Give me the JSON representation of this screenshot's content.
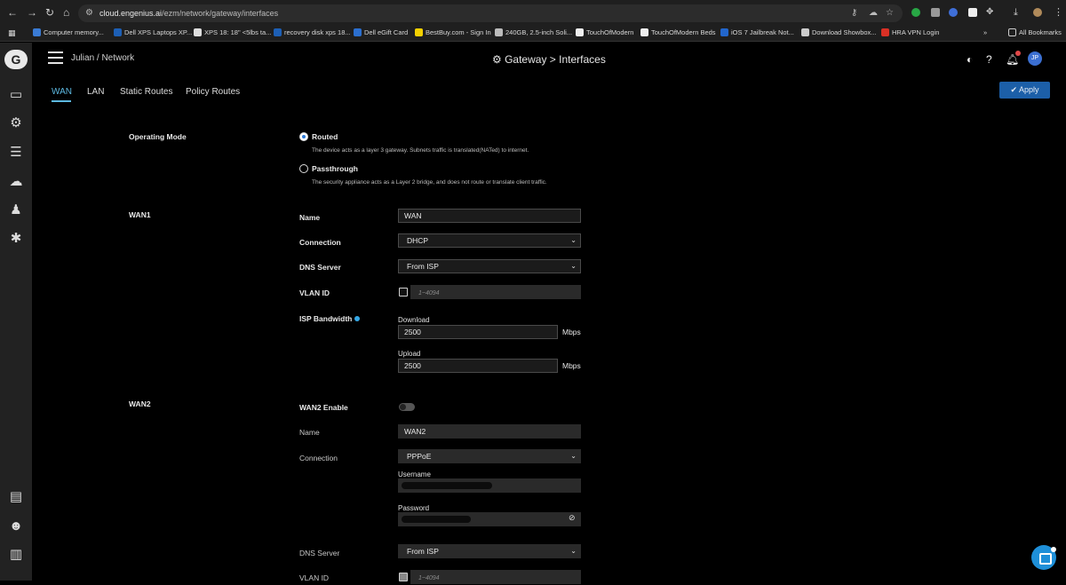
{
  "browser": {
    "url_host": "cloud.engenius.ai",
    "url_path": "/ezm/network/gateway/interfaces",
    "bookmarks": [
      {
        "label": "Computer memory...",
        "color": "#3a7bd5"
      },
      {
        "label": "Dell XPS Laptops XP...",
        "color": "#1d5fb5"
      },
      {
        "label": "XPS 18: 18\" <5lbs ta...",
        "color": "#dddddd"
      },
      {
        "label": "recovery disk xps 18...",
        "color": "#1d5fb5"
      },
      {
        "label": "Dell eGift Card",
        "color": "#2b6fcf"
      },
      {
        "label": "BestBuy.com - Sign In",
        "color": "#f3d000"
      },
      {
        "label": "240GB, 2.5-inch Soli...",
        "color": "#bbbbbb"
      },
      {
        "label": "TouchOfModern",
        "color": "#eeeeee"
      },
      {
        "label": "TouchOfModern Beds",
        "color": "#eeeeee"
      },
      {
        "label": "iOS 7 Jailbreak Not...",
        "color": "#2266cc"
      },
      {
        "label": "Download Showbox...",
        "color": "#cccccc"
      },
      {
        "label": "HRA VPN Login",
        "color": "#d93025"
      }
    ],
    "all_bookmarks": "All Bookmarks"
  },
  "header": {
    "breadcrumb": "Julian / Network",
    "title": "Gateway > Interfaces",
    "avatar": "JP"
  },
  "tabs": [
    "WAN",
    "LAN",
    "Static Routes",
    "Policy Routes"
  ],
  "apply_label": "Apply",
  "operating_mode": {
    "label": "Operating Mode",
    "routed": {
      "label": "Routed",
      "desc": "The device acts as a layer 3 gateway. Subnets traffic is translated(NATed) to internet."
    },
    "passthrough": {
      "label": "Passthrough",
      "desc": "The security appliance acts as a Layer 2 bridge, and does not route or translate client traffic."
    }
  },
  "wan1": {
    "section": "WAN1",
    "name_label": "Name",
    "name_value": "WAN",
    "connection_label": "Connection",
    "connection_value": "DHCP",
    "dns_label": "DNS Server",
    "dns_value": "From ISP",
    "vlan_label": "VLAN ID",
    "vlan_placeholder": "1~4094",
    "bandwidth_label": "ISP Bandwidth",
    "download_label": "Download",
    "download_value": "2500",
    "upload_label": "Upload",
    "upload_value": "2500",
    "unit": "Mbps"
  },
  "wan2": {
    "section": "WAN2",
    "enable_label": "WAN2 Enable",
    "name_label": "Name",
    "name_value": "WAN2",
    "connection_label": "Connection",
    "connection_value": "PPPoE",
    "username_label": "Username",
    "password_label": "Password",
    "dns_label": "DNS Server",
    "dns_value": "From ISP",
    "vlan_label": "VLAN ID",
    "vlan_placeholder": "1~4094"
  }
}
